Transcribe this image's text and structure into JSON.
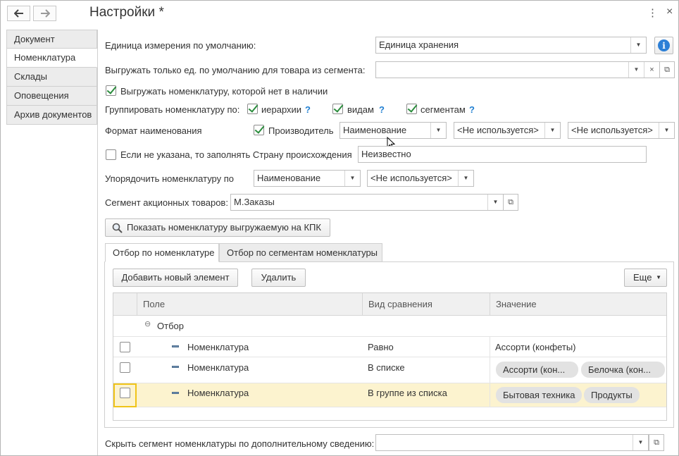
{
  "window": {
    "title": "Настройки *",
    "back_icon": "arrow-left-icon",
    "forward_icon": "arrow-right-icon",
    "more_icon": "⋮",
    "close_icon": "×"
  },
  "sidebar": {
    "items": [
      {
        "label": "Документ"
      },
      {
        "label": "Номенклатура"
      },
      {
        "label": "Склады"
      },
      {
        "label": "Оповещения"
      },
      {
        "label": "Архив документов"
      }
    ],
    "active_index": 1
  },
  "form": {
    "default_unit": {
      "label": "Единица измерения по умолчанию:",
      "value": "Единица хранения"
    },
    "export_default_only": {
      "label": "Выгружать только ед. по умолчанию для товара из сегмента:",
      "value": ""
    },
    "export_out_of_stock": {
      "label": "Выгружать номенклатуру, которой нет в наличии",
      "checked": true
    },
    "group_by": {
      "label": "Группировать номенклатуру по:",
      "options": [
        {
          "label": "иерархии",
          "checked": true,
          "help": "?"
        },
        {
          "label": "видам",
          "checked": true,
          "help": "?"
        },
        {
          "label": "сегментам",
          "checked": true,
          "help": "?"
        }
      ]
    },
    "name_format": {
      "label": "Формат наименования",
      "manufacturer": {
        "label": "Производитель",
        "checked": true
      },
      "select1": "Наименование",
      "select2": "<Не используется>",
      "select3": "<Не используется>"
    },
    "fill_country": {
      "label": "Если не указана, то заполнять Страну происхождения",
      "checked": false,
      "value": "Неизвестно"
    },
    "order_by": {
      "label": "Упорядочить номенклатуру по",
      "select1": "Наименование",
      "select2": "<Не используется>"
    },
    "promo_segment": {
      "label": "Сегмент акционных товаров:",
      "value": "М.Заказы"
    },
    "show_button": {
      "label": "Показать номенклатуру выгружаемую на КПК"
    },
    "hide_segment": {
      "label": "Скрыть сегмент номенклатуры по дополнительному сведению:",
      "value": ""
    }
  },
  "tabs": [
    {
      "label": "Отбор по номенклатуре",
      "active": true
    },
    {
      "label": "Отбор по сегментам номенклатуры",
      "active": false
    }
  ],
  "filter": {
    "add_button": "Добавить новый элемент",
    "delete_button": "Удалить",
    "more_button": "Еще",
    "columns": [
      "Поле",
      "Вид сравнения",
      "Значение"
    ],
    "group_label": "Отбор",
    "rows": [
      {
        "field": "Номенклатура",
        "comparison": "Равно",
        "values": [
          "Ассорти (конфеты)"
        ],
        "checked": false
      },
      {
        "field": "Номенклатура",
        "comparison": "В списке",
        "values": [
          "Ассорти (кон...",
          "Белочка (кон..."
        ],
        "checked": false
      },
      {
        "field": "Номенклатура",
        "comparison": "В группе из списка",
        "values": [
          "Бытовая техника",
          "Продукты"
        ],
        "checked": false,
        "selected": true
      }
    ]
  },
  "colors": {
    "accent": "#2c7fd6",
    "check": "#2a8c3c",
    "help": "#1f7ed1",
    "selected_row": "#fcf3cf",
    "selected_border": "#f0c419"
  }
}
